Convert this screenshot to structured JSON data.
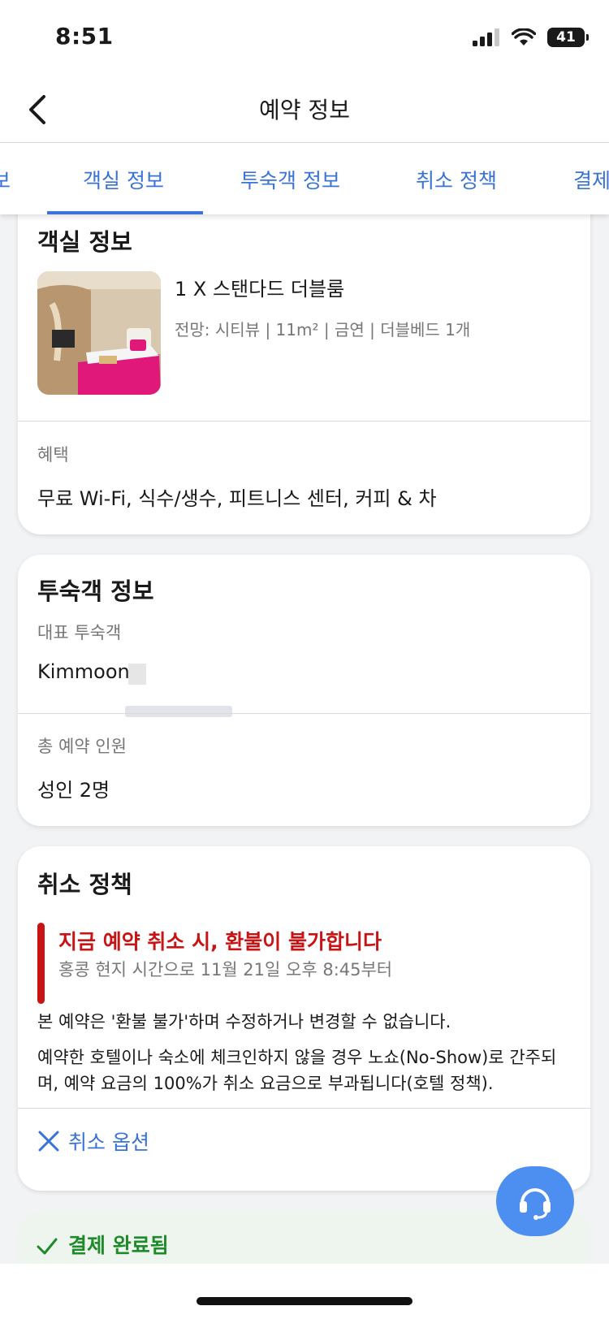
{
  "status_bar": {
    "time": "8:51",
    "battery": "41"
  },
  "header": {
    "title": "예약 정보"
  },
  "tabs": [
    {
      "label": "보"
    },
    {
      "label": "객실 정보"
    },
    {
      "label": "투숙객 정보"
    },
    {
      "label": "취소 정책"
    },
    {
      "label": "결제"
    }
  ],
  "room_section": {
    "title": "객실 정보",
    "room_name": "1 X 스탠다드 더블룸",
    "room_details": "전망: 시티뷰 | 11m² | 금연 | 더블베드 1개",
    "benefits_label": "혜택",
    "benefits_value": "무료 Wi-Fi, 식수/생수, 피트니스 센터, 커피 & 차"
  },
  "guest_section": {
    "title": "투숙객 정보",
    "main_guest_label": "대표 투숙객",
    "main_guest_value": "Kimmoon",
    "total_guests_label": "총 예약 인원",
    "total_guests_value": "성인 2명"
  },
  "cancel_section": {
    "title": "취소 정책",
    "refund_title": "지금 예약 취소 시, 환불이 불가합니다",
    "refund_subtitle": "홍콩 현지 시간으로 11월 21일 오후 8:45부터",
    "policy_line1": "본 예약은 '환불 불가'하며 수정하거나 변경할 수 없습니다.",
    "policy_line2": "예약한 호텔이나 숙소에 체크인하지 않을 경우 노쇼(No-Show)로 간주되며, 예약 요금의 100%가 취소 요금으로 부과됩니다(호텔 정책).",
    "cancel_options_label": "취소 옵션"
  },
  "payment": {
    "label": "결제 완료됨"
  },
  "colors": {
    "accent_blue": "#3a73d6",
    "refund_red": "#c81414",
    "paid_green": "#1f8a2a",
    "fab_blue": "#4d8ff0"
  },
  "icons": {
    "back": "chevron-left-icon",
    "cancel": "x-icon",
    "paid": "check-icon",
    "support": "headset-icon",
    "signal": "signal-icon",
    "wifi": "wifi-icon"
  }
}
